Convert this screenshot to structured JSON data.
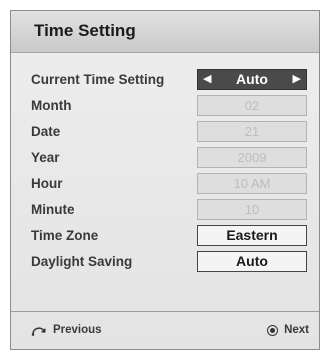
{
  "dialog": {
    "title": "Time Setting"
  },
  "rows": [
    {
      "label": "Current Time Setting",
      "value": "Auto",
      "state": "selected"
    },
    {
      "label": "Month",
      "value": "02",
      "state": "disabled"
    },
    {
      "label": "Date",
      "value": "21",
      "state": "disabled"
    },
    {
      "label": "Year",
      "value": "2009",
      "state": "disabled"
    },
    {
      "label": "Hour",
      "value": "10 AM",
      "state": "disabled"
    },
    {
      "label": "Minute",
      "value": "10",
      "state": "disabled"
    },
    {
      "label": "Time Zone",
      "value": "Eastern",
      "state": "enabled"
    },
    {
      "label": "Daylight Saving",
      "value": "Auto",
      "state": "enabled"
    }
  ],
  "footer": {
    "previous_label": "Previous",
    "next_label": "Next",
    "previous_icon": "return-icon",
    "next_icon": "ok-button-icon"
  }
}
